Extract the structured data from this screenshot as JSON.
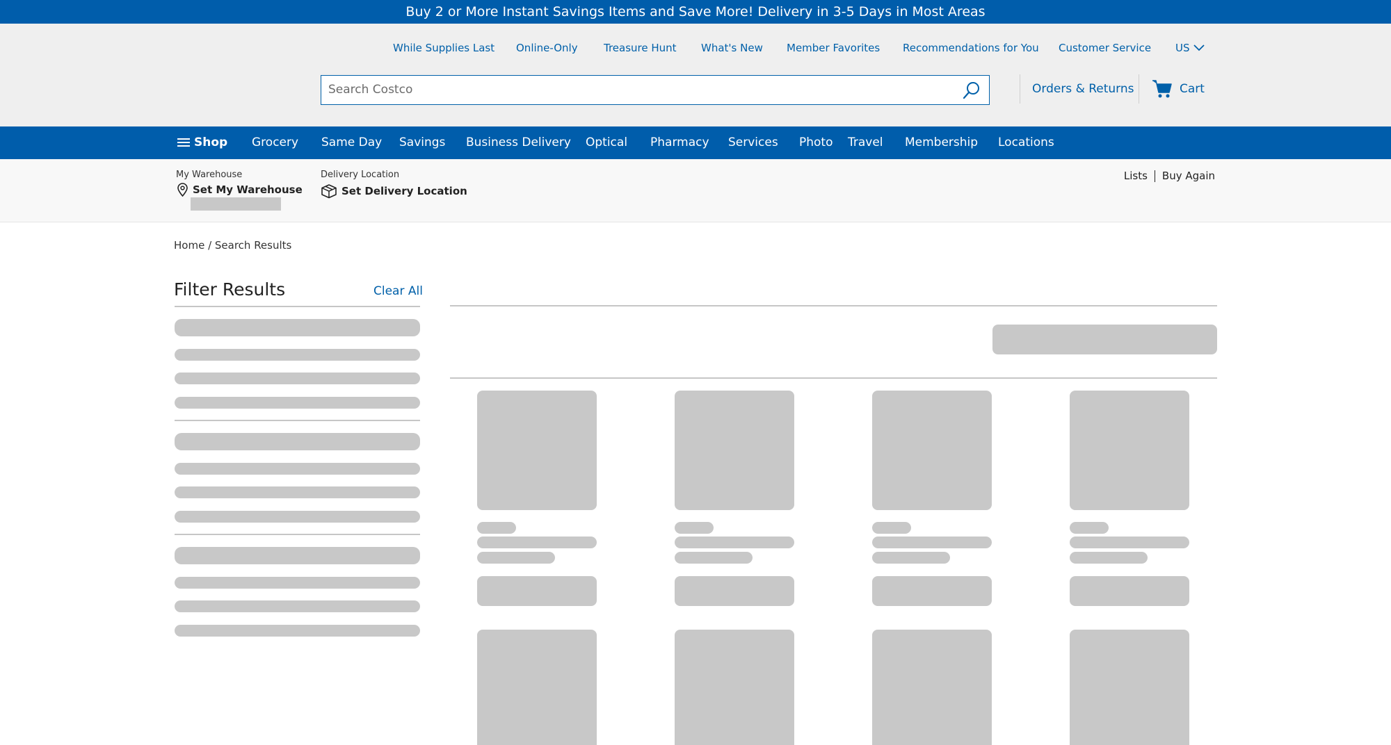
{
  "promo_banner": "Buy 2 or More Instant Savings Items and Save More! Delivery in 3-5 Days in Most Areas",
  "utility_nav": [
    "While Supplies Last",
    "Online-Only",
    "Treasure Hunt",
    "What's New",
    "Member Favorites",
    "Recommendations for You",
    "Customer Service"
  ],
  "country": "US",
  "search": {
    "placeholder": "Search Costco"
  },
  "orders_label": "Orders & Returns",
  "cart_label": "Cart",
  "main_nav": {
    "shop": "Shop",
    "items": [
      "Grocery",
      "Same Day",
      "Savings",
      "Business Delivery",
      "Optical",
      "Pharmacy",
      "Services",
      "Photo",
      "Travel",
      "Membership",
      "Locations"
    ]
  },
  "warehouse": {
    "label": "My Warehouse",
    "action": "Set My Warehouse"
  },
  "delivery": {
    "label": "Delivery Location",
    "action": "Set Delivery Location"
  },
  "top_links": {
    "lists": "Lists",
    "buy_again": "Buy Again"
  },
  "breadcrumb": "Home / Search Results",
  "filters": {
    "title": "Filter Results",
    "clear_all": "Clear All"
  },
  "colors": {
    "brand_blue": "#005dab",
    "link_blue": "#0060a9",
    "skeleton": "#c8c8c8",
    "header_bg": "#efefef"
  }
}
